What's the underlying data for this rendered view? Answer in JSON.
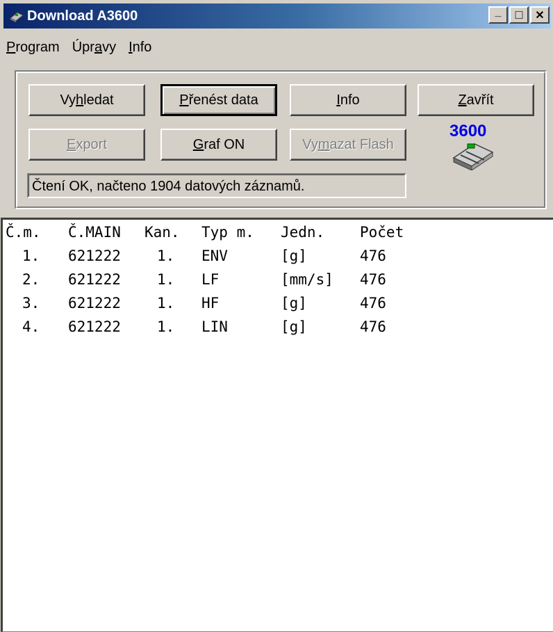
{
  "window": {
    "title": "Download A3600",
    "minimize_glyph": "_",
    "maximize_glyph": "□",
    "close_glyph": "✕"
  },
  "menu": [
    {
      "label": "Program",
      "access_key": "P"
    },
    {
      "label": "Úpravy",
      "access_key": "a"
    },
    {
      "label": "Info",
      "access_key": "I"
    }
  ],
  "buttons": {
    "vyhledat": {
      "label": "Vyhledat",
      "enabled": true
    },
    "prenest": {
      "label": "Přenést data",
      "enabled": true,
      "default": true
    },
    "info": {
      "label": "Info",
      "enabled": true
    },
    "zavrit": {
      "label": "Zavřít",
      "enabled": true
    },
    "export": {
      "label": "Export",
      "enabled": false
    },
    "graf": {
      "label": "Graf ON",
      "enabled": true
    },
    "vymazat": {
      "label": "Vymazat Flash",
      "enabled": false
    }
  },
  "status_text": "Čtení OK, načteno 1904  datových záznamů.",
  "logo_text": "3600",
  "table": {
    "columns": [
      "Č.m.",
      "Č.MAIN",
      "Kan.",
      "Typ m.",
      "Jedn.",
      "Počet"
    ],
    "rows": [
      [
        "1.",
        "621222",
        "1.",
        "ENV",
        "[g]",
        "476"
      ],
      [
        "2.",
        "621222",
        "1.",
        "LF",
        "[mm/s]",
        "476"
      ],
      [
        "3.",
        "621222",
        "1.",
        "HF",
        "[g]",
        "476"
      ],
      [
        "4.",
        "621222",
        "1.",
        "LIN",
        "[g]",
        "476"
      ]
    ]
  },
  "colors": {
    "face": "#d4d0c8",
    "title_start": "#0a246a",
    "title_end": "#a6caf0",
    "logo_blue": "#0000e6"
  }
}
